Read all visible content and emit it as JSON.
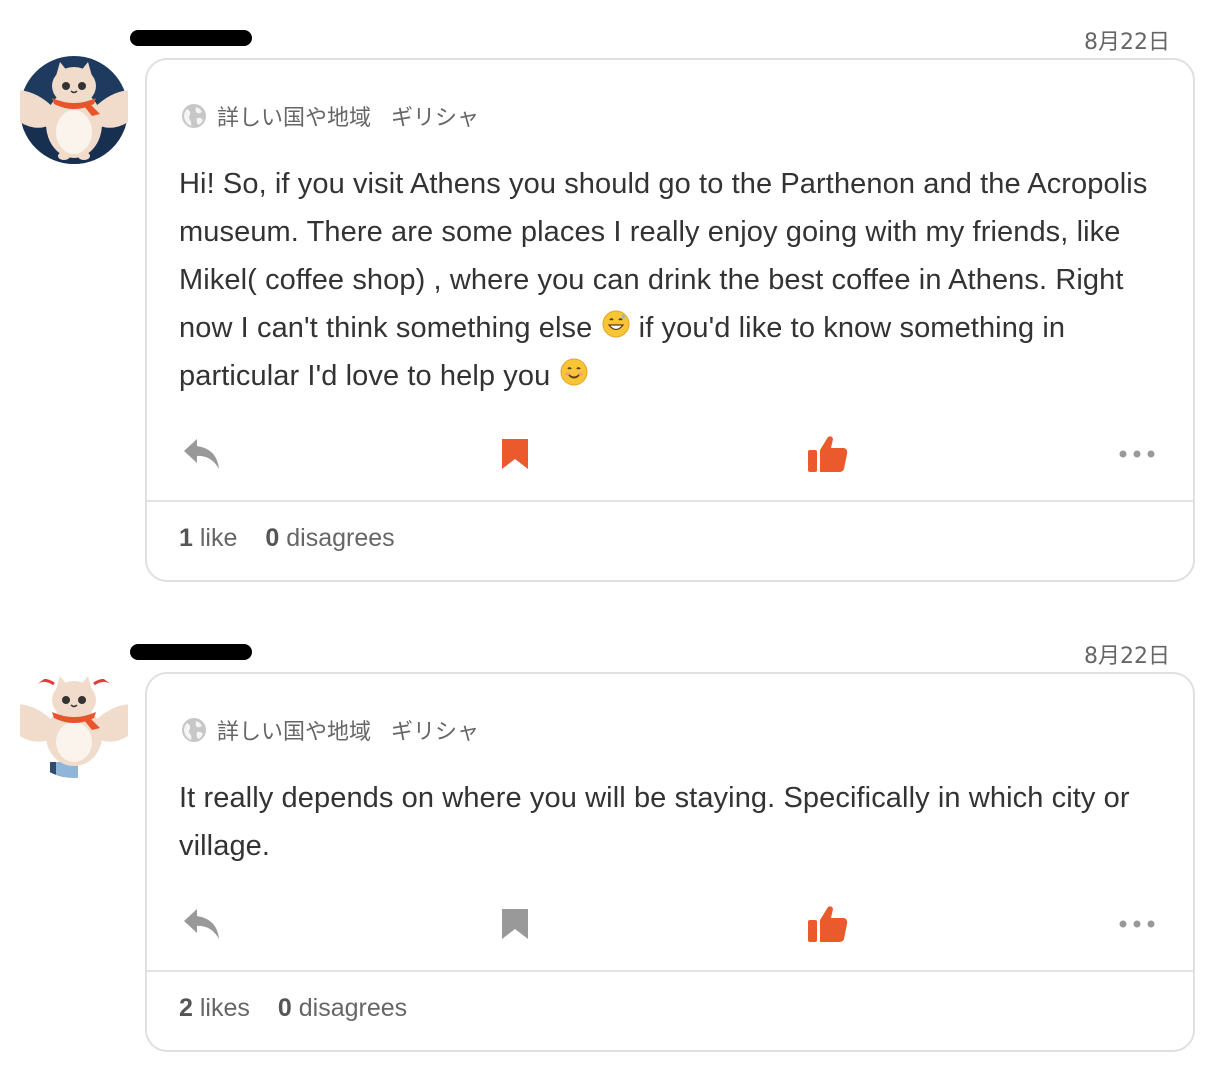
{
  "answers": [
    {
      "date": "8月22日",
      "language_label": "詳しい国や地域",
      "language_value": "ギリシャ",
      "text_parts": [
        "Hi! So, if you visit Athens you should go to the Parthenon and the Acropolis museum. There are some places I really enjoy going with my friends, like Mikel( coffee shop) , where you can drink the best coffee in Athens. Right now I can't think something else ",
        "  if you'd like to know something in particular I'd love to help you "
      ],
      "emojis": [
        "grinning-sweat-emoji",
        "smiling-emoji"
      ],
      "bookmark_active": true,
      "like_count": "1",
      "like_label": "like",
      "disagree_count": "0",
      "disagree_label": "disagrees"
    },
    {
      "date": "8月22日",
      "language_label": "詳しい国や地域",
      "language_value": "ギリシャ",
      "text": "It really depends on where you will be staying. Specifically in which city or village.",
      "bookmark_active": false,
      "like_count": "2",
      "like_label": "likes",
      "disagree_count": "0",
      "disagree_label": "disagrees"
    }
  ],
  "colors": {
    "accent": "#ea5a2c",
    "icon_gray": "#999999",
    "text": "#333333",
    "border": "#e0e0e0"
  }
}
